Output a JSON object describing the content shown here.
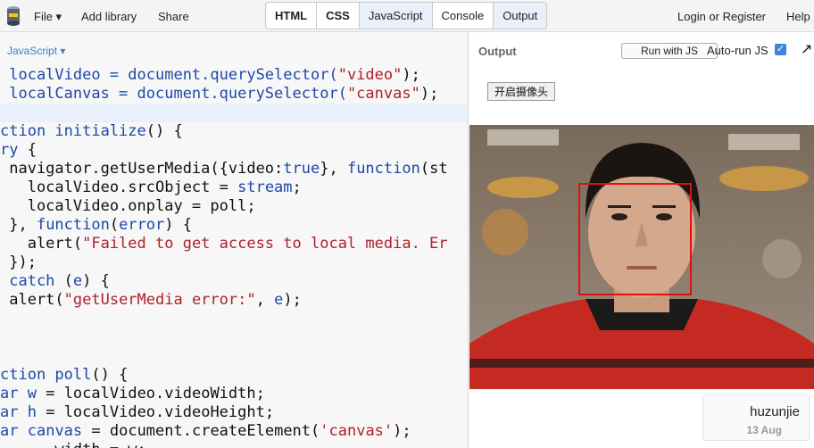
{
  "nav": {
    "file": "File ▾",
    "add_library": "Add library",
    "share": "Share",
    "login": "Login or Register",
    "help": "Help"
  },
  "tabs": [
    "HTML",
    "CSS",
    "JavaScript",
    "Console",
    "Output"
  ],
  "editor": {
    "language": "JavaScript ▾",
    "lines": [
      [
        {
          "t": " localVideo = document.querySelector(",
          "c": "var"
        },
        {
          "t": "\"video\"",
          "c": "str"
        },
        {
          "t": ");",
          "c": ""
        }
      ],
      [
        {
          "t": " localCanvas = document.querySelector(",
          "c": "var"
        },
        {
          "t": "\"canvas\"",
          "c": "str"
        },
        {
          "t": ");",
          "c": ""
        }
      ],
      [
        {
          "t": "",
          "c": ""
        }
      ],
      [
        {
          "t": "ction initialize",
          "c": "kw"
        },
        {
          "t": "() {",
          "c": ""
        }
      ],
      [
        {
          "t": "ry",
          "c": "kw"
        },
        {
          "t": " {",
          "c": ""
        }
      ],
      [
        {
          "t": " navigator.getUserMedia({video:",
          "c": ""
        },
        {
          "t": "true",
          "c": "kw"
        },
        {
          "t": "}, ",
          "c": ""
        },
        {
          "t": "function",
          "c": "kw"
        },
        {
          "t": "(st",
          "c": ""
        }
      ],
      [
        {
          "t": "   localVideo.srcObject = ",
          "c": ""
        },
        {
          "t": "stream",
          "c": "var"
        },
        {
          "t": ";",
          "c": ""
        }
      ],
      [
        {
          "t": "   localVideo.onplay = poll;",
          "c": ""
        }
      ],
      [
        {
          "t": " }, ",
          "c": ""
        },
        {
          "t": "function",
          "c": "kw"
        },
        {
          "t": "(",
          "c": ""
        },
        {
          "t": "error",
          "c": "var"
        },
        {
          "t": ") {",
          "c": ""
        }
      ],
      [
        {
          "t": "   alert(",
          "c": ""
        },
        {
          "t": "\"Failed to get access to local media. Er",
          "c": "str"
        }
      ],
      [
        {
          "t": " });",
          "c": ""
        }
      ],
      [
        {
          "t": " catch",
          "c": "kw"
        },
        {
          "t": " (",
          "c": ""
        },
        {
          "t": "e",
          "c": "var"
        },
        {
          "t": ") {",
          "c": ""
        }
      ],
      [
        {
          "t": " alert(",
          "c": ""
        },
        {
          "t": "\"getUserMedia error:\"",
          "c": "str"
        },
        {
          "t": ", ",
          "c": ""
        },
        {
          "t": "e",
          "c": "var"
        },
        {
          "t": ");",
          "c": ""
        }
      ],
      [
        {
          "t": "",
          "c": ""
        }
      ],
      [
        {
          "t": "",
          "c": ""
        }
      ],
      [
        {
          "t": "",
          "c": ""
        }
      ],
      [
        {
          "t": "ction poll",
          "c": "kw"
        },
        {
          "t": "() {",
          "c": ""
        }
      ],
      [
        {
          "t": "ar",
          "c": "kw"
        },
        {
          "t": " ",
          "c": ""
        },
        {
          "t": "w",
          "c": "var"
        },
        {
          "t": " = localVideo.videoWidth;",
          "c": ""
        }
      ],
      [
        {
          "t": "ar",
          "c": "kw"
        },
        {
          "t": " ",
          "c": ""
        },
        {
          "t": "h",
          "c": "var"
        },
        {
          "t": " = localVideo.videoHeight;",
          "c": ""
        }
      ],
      [
        {
          "t": "ar",
          "c": "kw"
        },
        {
          "t": " ",
          "c": ""
        },
        {
          "t": "canvas",
          "c": "var"
        },
        {
          "t": " = document.createElement(",
          "c": ""
        },
        {
          "t": "'canvas'",
          "c": "str"
        },
        {
          "t": ");",
          "c": ""
        }
      ],
      [
        {
          "t": "      width = w;",
          "c": ""
        }
      ]
    ]
  },
  "output": {
    "label": "Output",
    "run_button": "Run with JS",
    "auto_run": "Auto-run JS",
    "auto_run_checked": true,
    "camera_button": "开启摄像头"
  },
  "user": {
    "name": "huzunjie",
    "date": "13 Aug"
  },
  "colors": {
    "keyword": "#1d48a8",
    "string": "#b0202a",
    "face_box": "#e01010",
    "accent": "#3a86e0"
  }
}
